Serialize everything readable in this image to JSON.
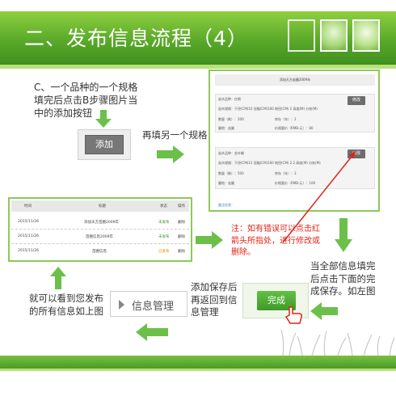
{
  "header": {
    "title": "二、发布信息流程（4）"
  },
  "steps": {
    "step_c": "C、一个品种的一个规格填完后点击B步骤图片当中的添加按钮",
    "refill": "再填另一个规格",
    "note": "注：如有错误可以点击红箭头所指处，进行修改或删除。",
    "all_done": "当全部信息填完后点击下面的完成保存。如左图",
    "add_save": "添加保存后再返回到信息管理",
    "see_all": "就可以看到您发布的所有信息如上图"
  },
  "buttons": {
    "add": "添加",
    "info_manage": "信息管理",
    "done": "完成",
    "edit_1": "修改",
    "edit_2": "修改"
  },
  "form": {
    "title": "添加天方苗圃2009年",
    "sec1": {
      "variety": "苗木品种：红枫",
      "spec": "苗木规格：干径(CM)10  冠幅(CM)100  地径(CM)  2 高度(M)  分枝(M)",
      "qty": "数量（株）：200",
      "stock_label": "库存（年）：2",
      "location": "圃地：苗圃",
      "price": "价格要价（RMB-元）：80"
    },
    "sec2": {
      "variety": "苗木品种：金叶榆",
      "spec": "苗木规格：干径(CM)12  冠幅(CM)100  地径(CM)  2.2 高度(M)  分枝(M)",
      "qty": "数量（株）：500",
      "stock_label": "库存（年）：3",
      "location": "圃地：苗圃",
      "price": "价格要价（RMB-元）：100"
    },
    "link": "备注信息："
  },
  "table": {
    "headers": [
      "时间",
      "标题",
      "状态",
      "操作"
    ],
    "rows": [
      [
        "2015/11/26",
        "添加天方苗圃2009年",
        "未发布",
        "删除"
      ],
      [
        "2015/11/26",
        "苗圃信息2009年",
        "未发布",
        "删除"
      ],
      [
        "2015/11/26",
        "苗圃信息",
        "已发布",
        "删除"
      ]
    ]
  },
  "colors": {
    "header_green": "#5aa92a",
    "arrow_green": "#6cc04a",
    "note_red": "#e0241a",
    "status_green": "#3a9a2b",
    "status_orange": "#e68a00"
  }
}
